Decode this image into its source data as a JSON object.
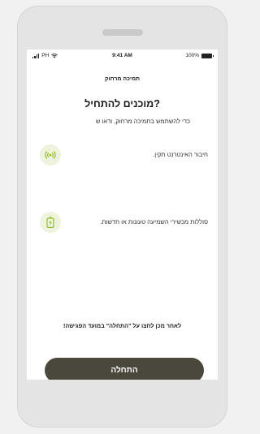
{
  "status_bar": {
    "carrier": "PH",
    "time": "9:41 AM",
    "battery": "100%"
  },
  "header": {
    "title": "תמיכה מרחוק"
  },
  "main": {
    "heading": "מוכנים להתחיל?",
    "subtitle": "כדי להשתמש בתמיכה מרחוק, ודאו ש",
    "items": [
      {
        "icon": "wireless-signal-icon",
        "label": "חיבור האינטרנט תקין."
      },
      {
        "icon": "battery-charging-icon",
        "label": "סוללות מכשירי השמיעה טעונות או חדשות."
      }
    ],
    "note": "לאחר מכן לחצו על \"התחלה\" במועד הפגישה!",
    "start_button": "התחלה"
  },
  "colors": {
    "button": "#4a473d",
    "icon_background": "#edf3dc",
    "icon_accent": "#8cb61f"
  }
}
